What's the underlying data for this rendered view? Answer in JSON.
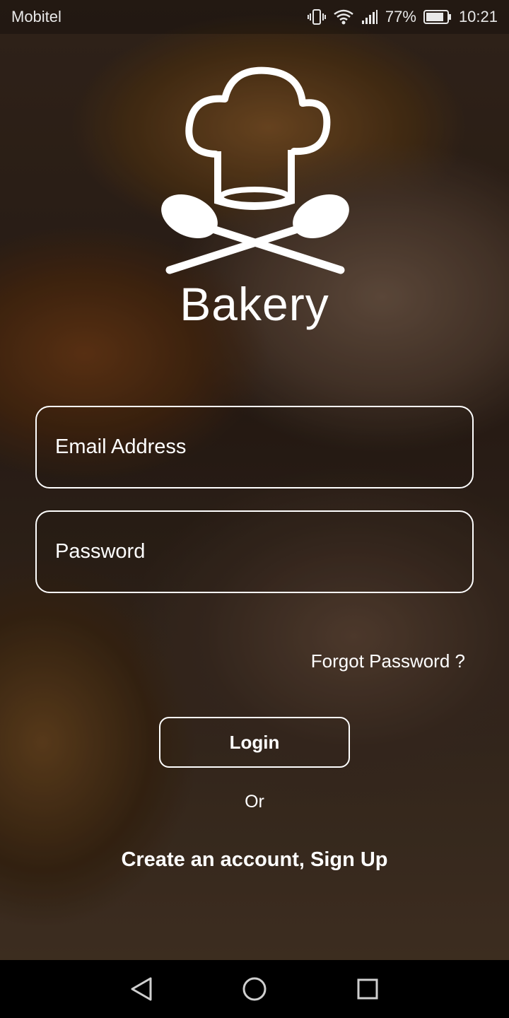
{
  "status_bar": {
    "carrier": "Mobitel",
    "battery_percent": "77%",
    "time": "10:21",
    "icons": [
      "vibrate-icon",
      "wifi-icon",
      "signal-icon",
      "battery-icon"
    ]
  },
  "app": {
    "title": "Bakery",
    "logo": "chef-hat-crossed-spoons-logo"
  },
  "form": {
    "email_placeholder": "Email Address",
    "email_value": "",
    "password_placeholder": "Password",
    "password_value": "",
    "forgot_label": "Forgot Password ?",
    "login_label": "Login",
    "or_label": "Or",
    "signup_label": "Create an account, Sign Up"
  },
  "nav": {
    "icons": [
      "back-icon",
      "home-icon",
      "recents-icon"
    ]
  },
  "colors": {
    "text": "#ffffff",
    "navbar": "#000000",
    "background_tone": "#3a2a1f"
  }
}
